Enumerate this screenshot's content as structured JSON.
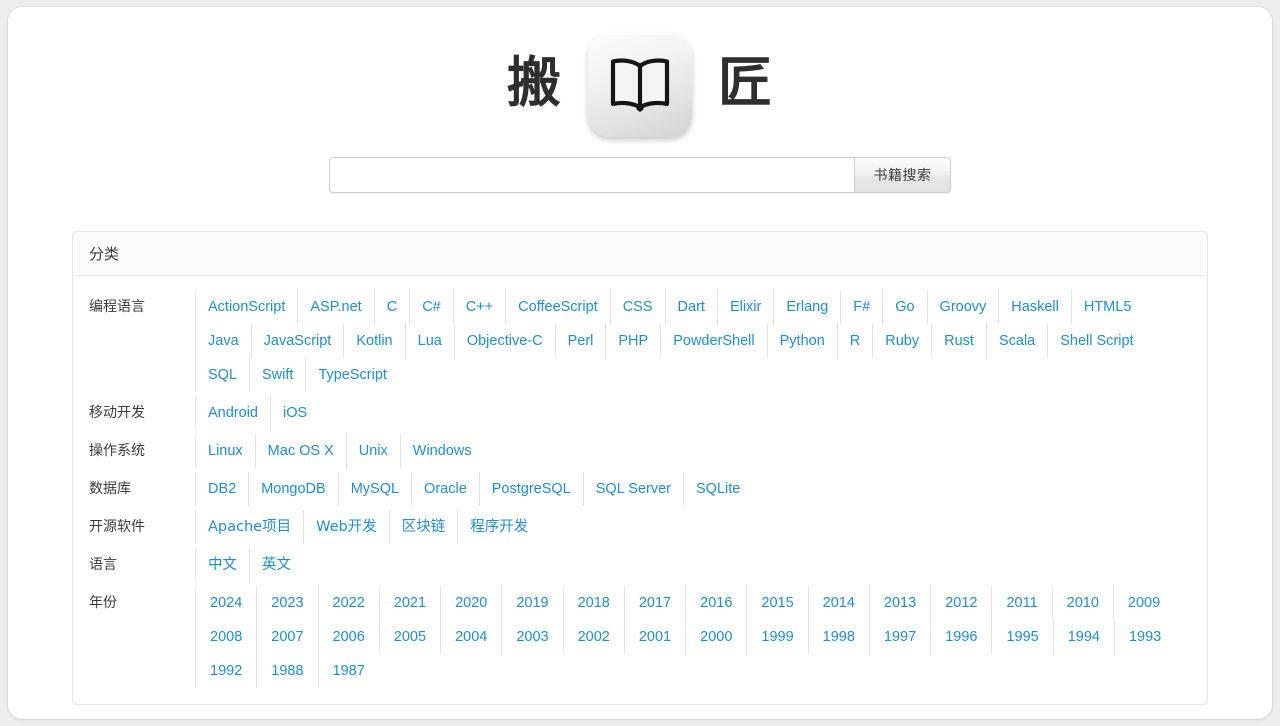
{
  "site": {
    "title_left": "搬",
    "title_right": "匠",
    "logo_icon": "open-book-icon"
  },
  "search": {
    "value": "",
    "placeholder": "",
    "button_label": "书籍搜索"
  },
  "colors": {
    "link": "#1f8dd6",
    "page_bg": "#eceded",
    "card_bg": "#ffffff",
    "panel_border": "#e6e6e6",
    "panel_header_bg": "#fcfcfc",
    "text": "#3b3b3b"
  },
  "panel": {
    "header": "分类",
    "rows": [
      {
        "label": "编程语言",
        "items": [
          "ActionScript",
          "ASP.net",
          "C",
          "C#",
          "C++",
          "CoffeeScript",
          "CSS",
          "Dart",
          "Elixir",
          "Erlang",
          "F#",
          "Go",
          "Groovy",
          "Haskell",
          "HTML5",
          "Java",
          "JavaScript",
          "Kotlin",
          "Lua",
          "Objective-C",
          "Perl",
          "PHP",
          "PowderShell",
          "Python",
          "R",
          "Ruby",
          "Rust",
          "Scala",
          "Shell Script",
          "SQL",
          "Swift",
          "TypeScript"
        ]
      },
      {
        "label": "移动开发",
        "items": [
          "Android",
          "iOS"
        ]
      },
      {
        "label": "操作系统",
        "items": [
          "Linux",
          "Mac OS X",
          "Unix",
          "Windows"
        ]
      },
      {
        "label": "数据库",
        "items": [
          "DB2",
          "MongoDB",
          "MySQL",
          "Oracle",
          "PostgreSQL",
          "SQL Server",
          "SQLite"
        ]
      },
      {
        "label": "开源软件",
        "items": [
          "Apache项目",
          "Web开发",
          "区块链",
          "程序开发"
        ]
      },
      {
        "label": "语言",
        "items": [
          "中文",
          "英文"
        ]
      },
      {
        "label": "年份",
        "items": [
          "2024",
          "2023",
          "2022",
          "2021",
          "2020",
          "2019",
          "2018",
          "2017",
          "2016",
          "2015",
          "2014",
          "2013",
          "2012",
          "2011",
          "2010",
          "2009",
          "2008",
          "2007",
          "2006",
          "2005",
          "2004",
          "2003",
          "2002",
          "2001",
          "2000",
          "1999",
          "1998",
          "1997",
          "1996",
          "1995",
          "1994",
          "1993",
          "1992",
          "1988",
          "1987"
        ]
      }
    ]
  }
}
